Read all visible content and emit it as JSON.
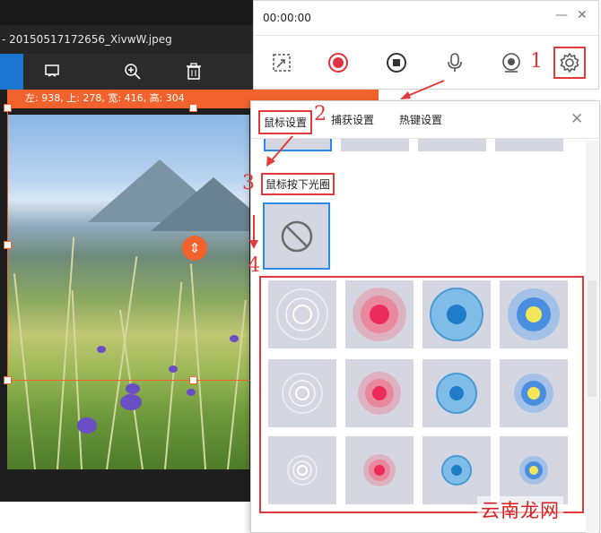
{
  "viewer": {
    "title": "- 20150517172656_XivwW.jpeg",
    "selection_info": "左: 938, 上: 278, 宽: 416, 高: 304"
  },
  "recorder": {
    "time": "00:00:00",
    "minimize": "—",
    "close": "✕",
    "tools": [
      "region-select",
      "record",
      "stop",
      "microphone",
      "webcam",
      "settings"
    ]
  },
  "settings": {
    "tabs": [
      "鼠标设置",
      "捕获设置",
      "热键设置"
    ],
    "close": "✕",
    "section_label": "鼠标按下光圈",
    "swatch_rows": [
      {
        "size": "large",
        "styles": [
          "white-ring",
          "pink",
          "blue-solid",
          "blue-yellow"
        ]
      },
      {
        "size": "medium",
        "styles": [
          "white-ring",
          "pink",
          "blue-solid",
          "blue-yellow"
        ]
      },
      {
        "size": "small",
        "styles": [
          "white-ring",
          "pink",
          "blue-solid",
          "blue-yellow"
        ]
      }
    ]
  },
  "annotations": {
    "step1": "1",
    "step2": "2",
    "step3": "3",
    "step4": "4"
  },
  "watermark": "云南龙网",
  "colors": {
    "accent_orange": "#f2622c",
    "annotation_red": "#e23a3a",
    "selection_blue": "#2b8be2",
    "tile_bg": "#d4d7e1"
  }
}
